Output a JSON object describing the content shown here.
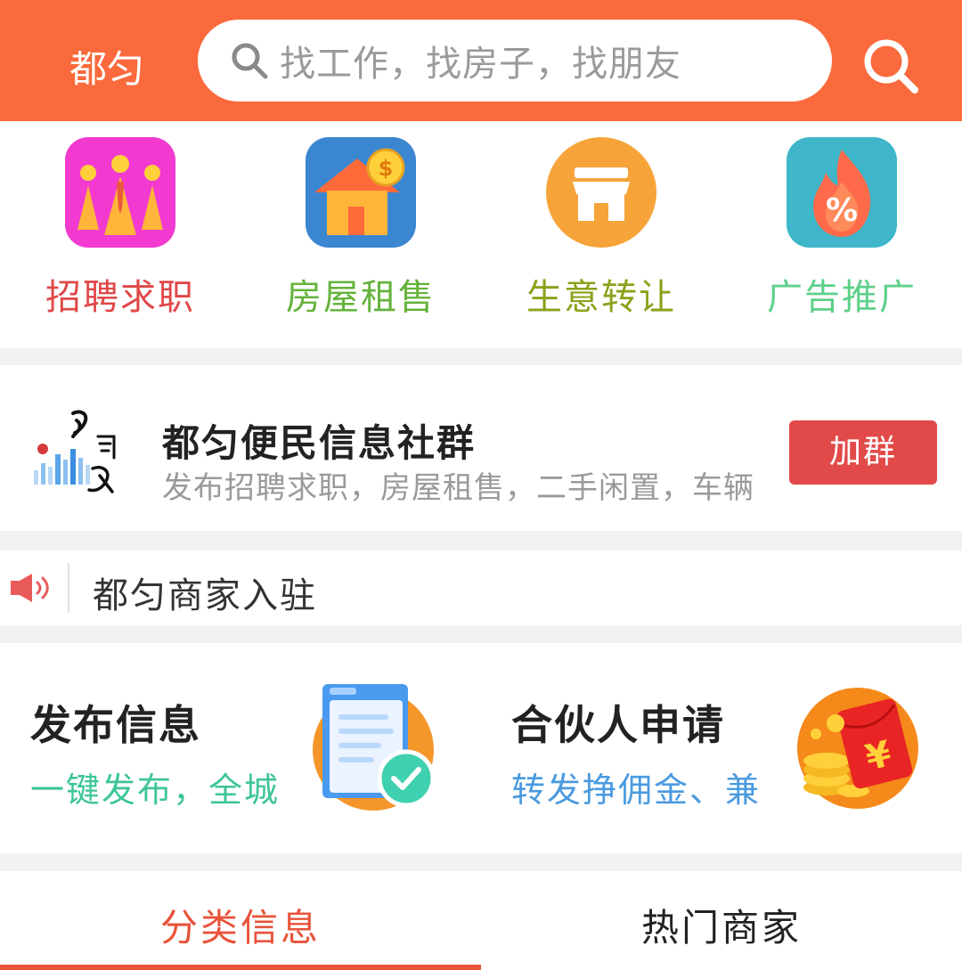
{
  "header": {
    "city": "都匀",
    "search_placeholder": "找工作，找房子，找朋友"
  },
  "categories": [
    {
      "label": "招聘求职",
      "color": "#e04848"
    },
    {
      "label": "房屋租售",
      "color": "#64b33b"
    },
    {
      "label": "生意转让",
      "color": "#8aa21a"
    },
    {
      "label": "广告推广",
      "color": "#5fd08a"
    }
  ],
  "community": {
    "title": "都匀便民信息社群",
    "subtitle": "发布招聘求职，房屋租售，二手闲置，车辆",
    "join_label": "加群"
  },
  "notice": {
    "text": "都匀商家入驻"
  },
  "promo": {
    "left": {
      "title": "发布信息",
      "subtitle": "一键发布，全城"
    },
    "right": {
      "title": "合伙人申请",
      "subtitle": "转发挣佣金、兼"
    }
  },
  "tabs": [
    {
      "label": "分类信息",
      "active": true
    },
    {
      "label": "热门商家",
      "active": false
    }
  ],
  "colors": {
    "brand": "#fa6a3c",
    "join_button": "#e24a4a",
    "active_tab": "#e8533a"
  }
}
